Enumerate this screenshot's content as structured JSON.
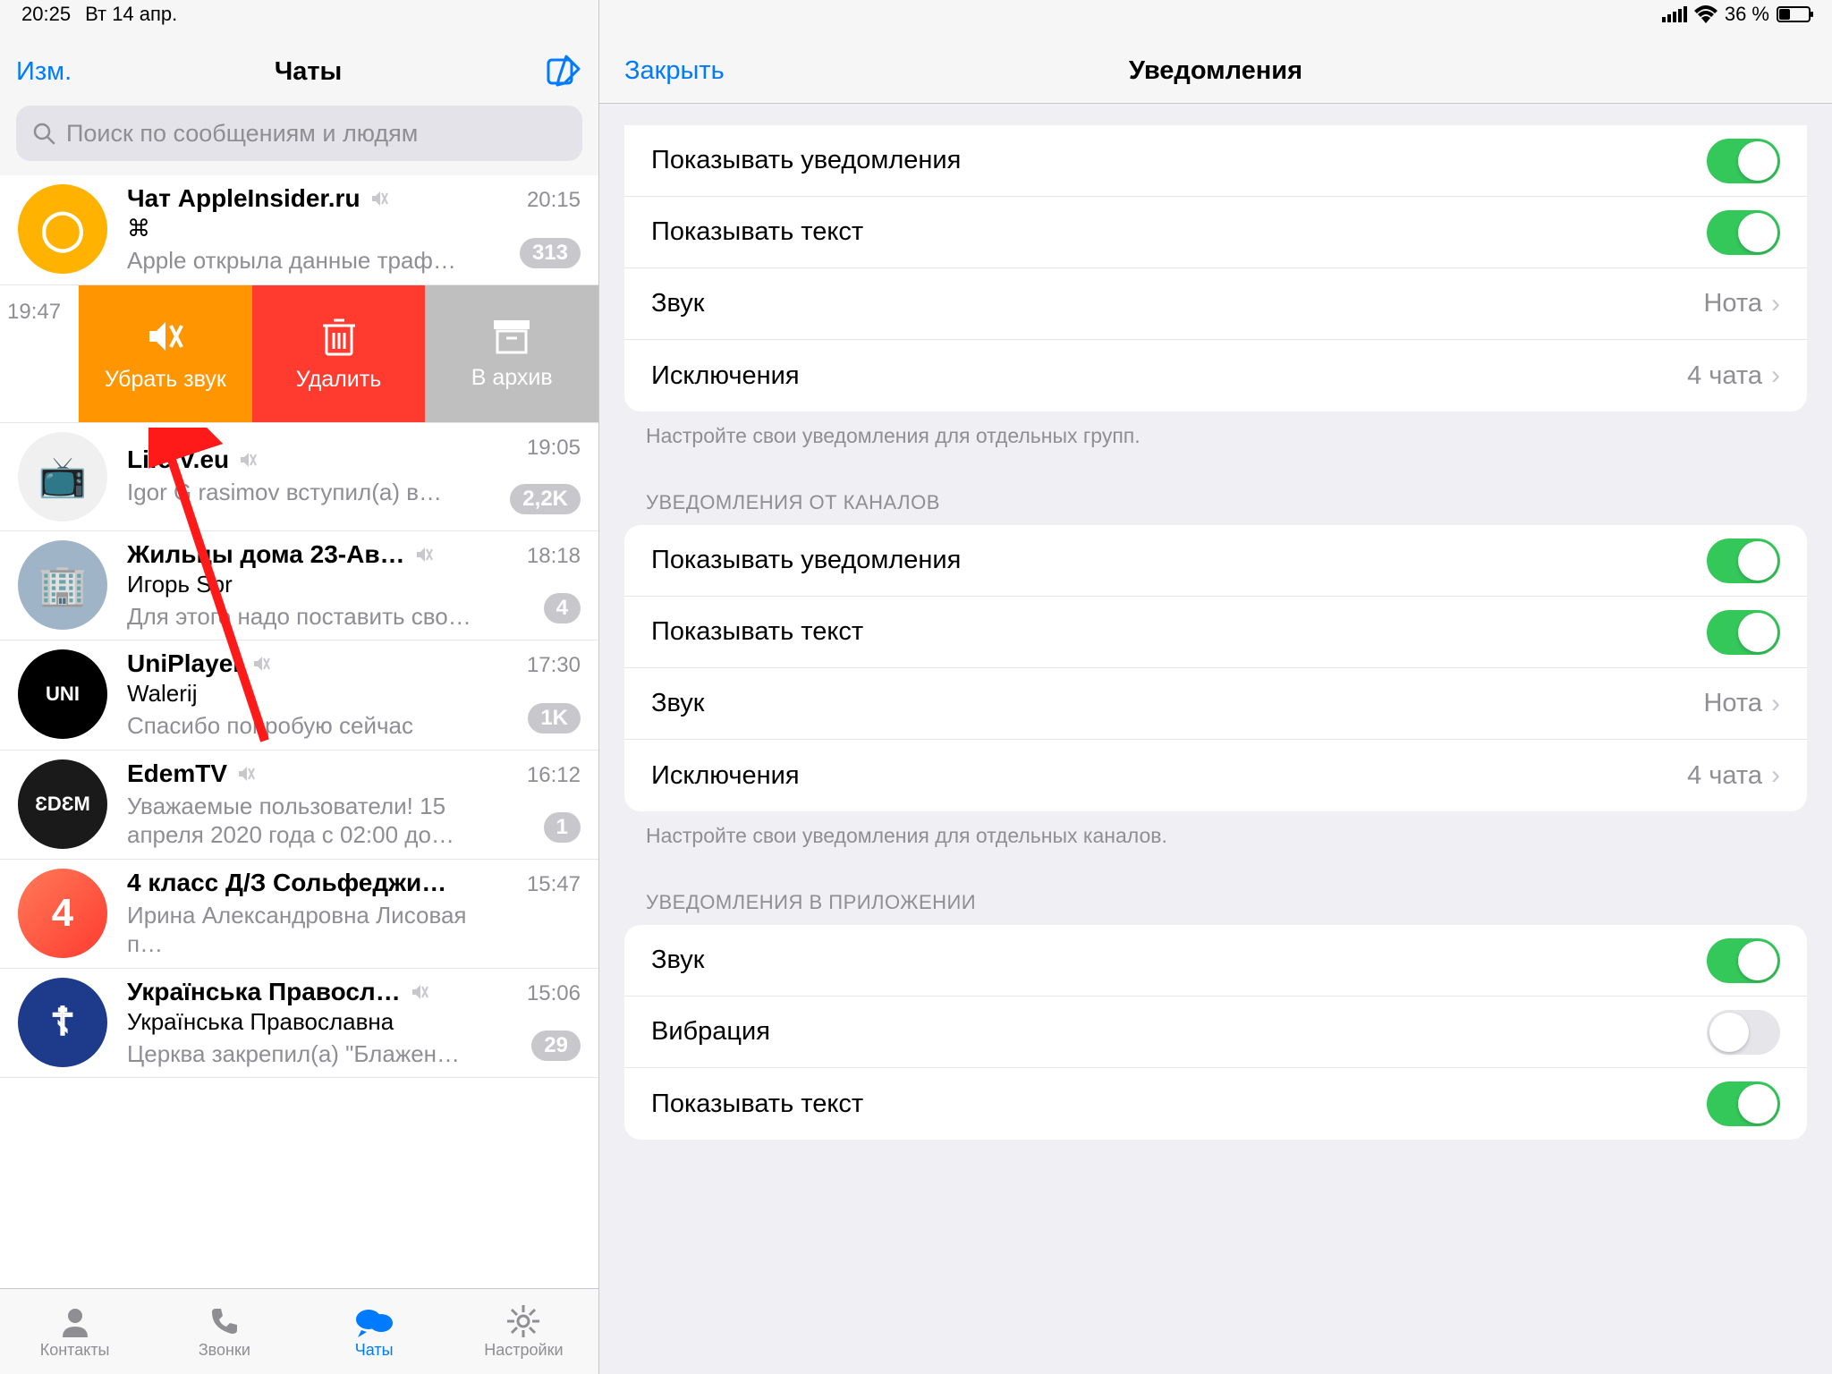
{
  "statusbar": {
    "time": "20:25",
    "date": "Вт 14 апр.",
    "battery": "36 %"
  },
  "left": {
    "edit": "Изм.",
    "title": "Чаты",
    "search_placeholder": "Поиск по сообщениям и людям",
    "swipe": {
      "time": "19:47",
      "mute": "Убрать звук",
      "delete": "Удалить",
      "archive": "В архив"
    },
    "chats": [
      {
        "name": "Чат AppleInsider.ru",
        "line1": "⌘",
        "preview": "Apple открыла данные траф…",
        "time": "20:15",
        "badge": "313",
        "muted": true,
        "bg": "#ffb300",
        "glyph": "◯"
      },
      {
        "name": "Life   V.eu",
        "preview": "Igor G rasimov вступил(а) в…",
        "time": "19:05",
        "badge": "2,2K",
        "muted": true,
        "bg": "#f0f0f0",
        "glyph": "📺"
      },
      {
        "name": "Жильцы дома 23-Ав…",
        "line1": "Игорь Spr",
        "preview": "Для этого надо поставить сво…",
        "time": "18:18",
        "badge": "4",
        "muted": true,
        "bg": "#a0b4c8",
        "glyph": "🏢"
      },
      {
        "name": "UniPlayer",
        "line1": "Walerij",
        "preview": "Спасибо попробую сейчас",
        "time": "17:30",
        "badge": "1K",
        "muted": true,
        "bg": "#000",
        "glyph": "UNI"
      },
      {
        "name": "EdemTV",
        "preview": "Уважаемые пользователи! 15 апреля 2020 года с 02:00 до…",
        "time": "16:12",
        "badge": "1",
        "muted": true,
        "bg": "#1a1a1a",
        "glyph": "ƐDƐM"
      },
      {
        "name": "4 класс Д/З Сольфеджи…",
        "preview": "Ирина Александровна Лисовая п…",
        "time": "15:47",
        "muted": false,
        "bg": "linear-gradient(135deg,#ff7a59,#ff3b30)",
        "glyph": "4"
      },
      {
        "name": "Українська Правосл…",
        "line1": "Українська Православна",
        "preview": "Церква закрепил(а) \"Блажен…",
        "time": "15:06",
        "badge": "29",
        "muted": true,
        "bg": "#1e3a8a",
        "glyph": "☦"
      }
    ]
  },
  "tabs": {
    "contacts": "Контакты",
    "calls": "Звонки",
    "chats": "Чаты",
    "settings": "Настройки"
  },
  "right": {
    "close": "Закрыть",
    "title": "Уведомления",
    "g1": {
      "show_notif": "Показывать уведомления",
      "show_text": "Показывать текст",
      "sound": "Звук",
      "sound_val": "Нота",
      "exceptions": "Исключения",
      "exceptions_val": "4 чата",
      "footer": "Настройте свои уведомления для отдельных групп."
    },
    "s2_header": "УВЕДОМЛЕНИЯ ОТ КАНАЛОВ",
    "g2": {
      "show_notif": "Показывать уведомления",
      "show_text": "Показывать текст",
      "sound": "Звук",
      "sound_val": "Нота",
      "exceptions": "Исключения",
      "exceptions_val": "4 чата",
      "footer": "Настройте свои уведомления для отдельных каналов."
    },
    "s3_header": "УВЕДОМЛЕНИЯ В ПРИЛОЖЕНИИ",
    "g3": {
      "sound": "Звук",
      "vibration": "Вибрация",
      "show_text": "Показывать текст"
    }
  }
}
